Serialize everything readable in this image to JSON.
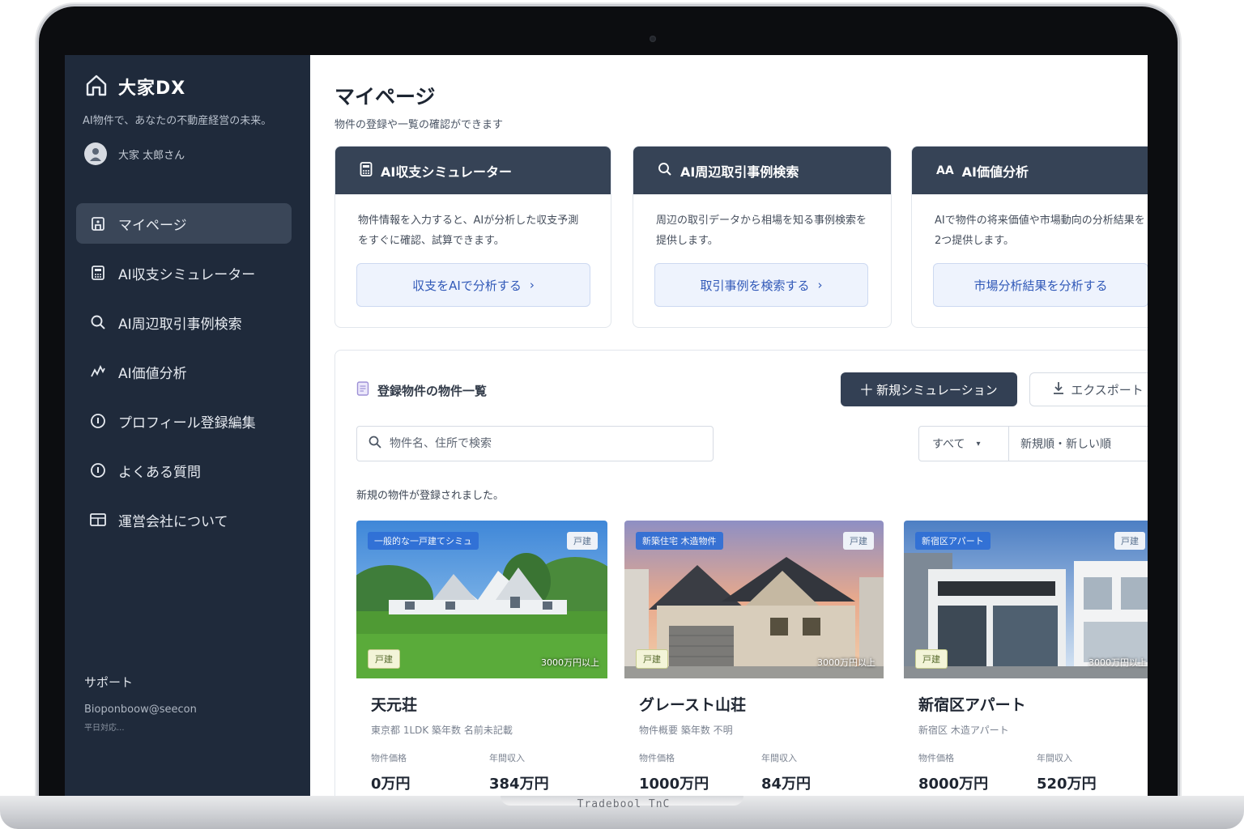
{
  "device": {
    "base_brand": "Tradebool TnC"
  },
  "sidebar": {
    "brand_title": "大家DX",
    "tagline": "AI物件で、あなたの不動産経営の未来。",
    "user_name": "大家 太郎さん",
    "items": [
      {
        "label": "マイページ",
        "icon": "home-icon",
        "active": true
      },
      {
        "label": "AI収支シミュレーター",
        "icon": "calculator-icon",
        "active": false
      },
      {
        "label": "AI周辺取引事例検索",
        "icon": "search-icon",
        "active": false
      },
      {
        "label": "AI価値分析",
        "icon": "chart-icon",
        "active": false
      },
      {
        "label": "プロフィール登録編集",
        "icon": "info-icon",
        "active": false
      },
      {
        "label": "よくある質問",
        "icon": "info-icon",
        "active": false
      },
      {
        "label": "運営会社について",
        "icon": "building-icon",
        "active": false
      }
    ],
    "support": {
      "title": "サポート",
      "email": "Bioponboow@seecon",
      "hours": "平日対応..."
    }
  },
  "main": {
    "title": "マイページ",
    "subtitle": "物件の登録や一覧の確認ができます",
    "features": [
      {
        "title": "AI収支シミュレーター",
        "icon": "calculator-icon",
        "desc": "物件情報を入力すると、AIが分析した収支予測をすぐに確認、試算できます。",
        "button": "収支をAIで分析する"
      },
      {
        "title": "AI周辺取引事例検索",
        "icon": "search-icon",
        "desc": "周辺の取引データから相場を知る事例検索を提供します。",
        "button": "取引事例を検索する"
      },
      {
        "title": "AI価値分析",
        "icon": "ai-text-icon",
        "desc": "AIで物件の将来価値や市場動向の分析結果を2つ提供します。",
        "button": "市場分析結果を分析する"
      }
    ],
    "list": {
      "heading": "登録物件の物件一覧",
      "new_button": "十 新規シミュレーション",
      "export_button": "エクスポート",
      "search_placeholder": "物件名、住所で検索",
      "filter_label": "すべて",
      "sort_label": "新規順・新しい順",
      "result_note": "新規の物件が登録されました。"
    },
    "properties": [
      {
        "name": "天元荘",
        "sub": "東京都 1LDK 築年数 名前未記載",
        "tag_top": "一般的な一戸建てシミュ",
        "tag_right": "戸建",
        "tag_bottom_left": "戸建",
        "tag_bottom_right": "3000万円以上",
        "stat1_label": "物件価格",
        "stat1_value": "0万円",
        "stat2_label": "年間収入",
        "stat2_value": "384万円"
      },
      {
        "name": "グレースト山荘",
        "sub": "物件概要 築年数 不明",
        "tag_top": "新築住宅 木造物件",
        "tag_right": "戸建",
        "tag_bottom_left": "戸建",
        "tag_bottom_right": "3000万円以上",
        "stat1_label": "物件価格",
        "stat1_value": "1000万円",
        "stat2_label": "年間収入",
        "stat2_value": "84万円"
      },
      {
        "name": "新宿区アパート",
        "sub": "新宿区 木造アパート",
        "tag_top": "新宿区アパート",
        "tag_right": "戸建",
        "tag_bottom_left": "戸建",
        "tag_bottom_right": "3000万円以上",
        "stat1_label": "物件価格",
        "stat1_value": "8000万円",
        "stat2_label": "年間収入",
        "stat2_value": "520万円"
      }
    ]
  },
  "colors": {
    "sidebar_bg": "#1f2a3b",
    "feature_head": "#364356",
    "primary_button": "#334054",
    "link_blue": "#3159b8"
  }
}
